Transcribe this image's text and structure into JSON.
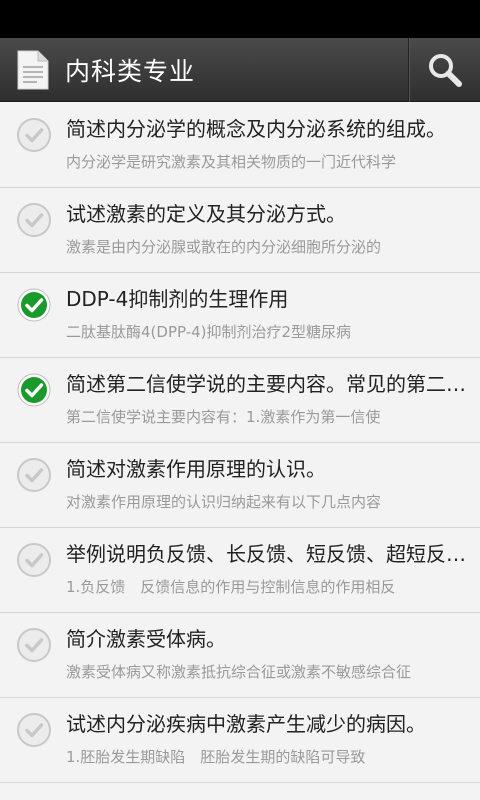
{
  "app_bar": {
    "title": "内科类专业",
    "doc_icon": "document-icon",
    "search_icon": "search-icon"
  },
  "colors": {
    "app_bar": "#3a3a3a",
    "checked": "#1a9a2a",
    "unchecked": "#c8c8c8"
  },
  "items": [
    {
      "title": "简述内分泌学的概念及内分泌系统的组成。",
      "subtitle": "内分泌学是研究激素及其相关物质的一门近代科学",
      "checked": false
    },
    {
      "title": "试述激素的定义及其分泌方式。",
      "subtitle": "激素是由内分泌腺或散在的内分泌细胞所分泌的",
      "checked": false
    },
    {
      "title": "DDP-4抑制剂的生理作用",
      "subtitle": "二肽基肽酶4(DPP-4)抑制剂治疗2型糖尿病",
      "checked": true
    },
    {
      "title": "简述第二信使学说的主要内容。常见的第二信使有哪些？",
      "subtitle": "第二信使学说主要内容有：1.激素作为第一信使",
      "checked": true
    },
    {
      "title": "简述对激素作用原理的认识。",
      "subtitle": "对激素作用原理的认识归纳起来有以下几点内容",
      "checked": false
    },
    {
      "title": "举例说明负反馈、长反馈、短反馈、超短反馈。",
      "subtitle": "1.负反馈　反馈信息的作用与控制信息的作用相反",
      "checked": false
    },
    {
      "title": "简介激素受体病。",
      "subtitle": "激素受体病又称激素抵抗综合征或激素不敏感综合征",
      "checked": false
    },
    {
      "title": "试述内分泌疾病中激素产生减少的病因。",
      "subtitle": "1.胚胎发生期缺陷　胚胎发生期的缺陷可导致",
      "checked": false
    }
  ]
}
